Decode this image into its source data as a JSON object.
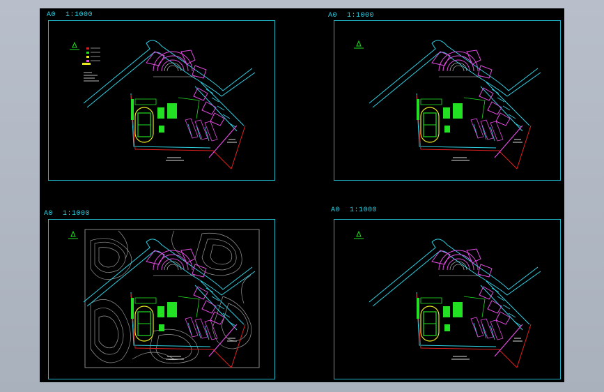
{
  "sheets": [
    {
      "size": "A0",
      "scale": "1:1000"
    },
    {
      "size": "A0",
      "scale": "1:1000"
    },
    {
      "size": "A0",
      "scale": "1:1000"
    },
    {
      "size": "A0",
      "scale": "1:1000"
    }
  ],
  "colors": {
    "background": "#000000",
    "frame": "#1fb7c9",
    "road": "#2fd2e6",
    "building": "#e14be0",
    "green": "#22e022",
    "red": "#e02020",
    "contour": "#9a9a9a"
  }
}
